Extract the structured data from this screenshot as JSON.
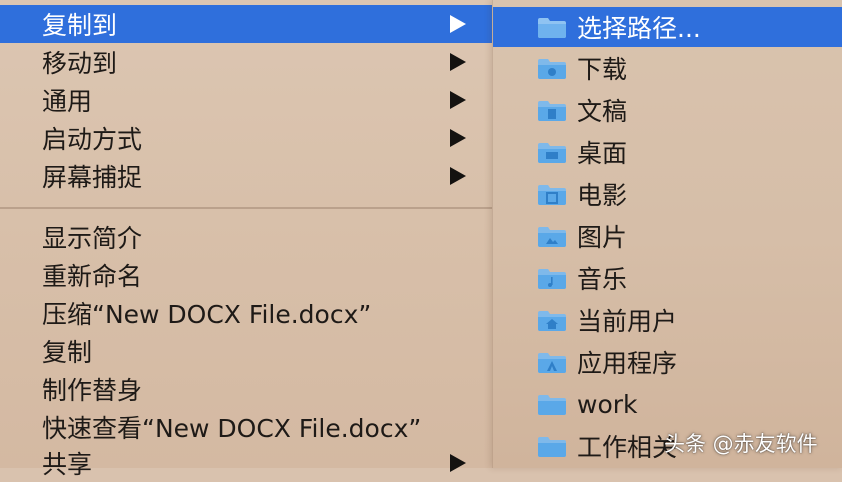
{
  "left_menu": {
    "items": [
      {
        "label": "复制到"
      },
      {
        "label": "移动到"
      },
      {
        "label": "通用"
      },
      {
        "label": "启动方式"
      },
      {
        "label": "屏幕捕捉"
      },
      {
        "label": "显示简介"
      },
      {
        "label": "重新命名"
      },
      {
        "label": "压缩“New DOCX File.docx”"
      },
      {
        "label": "复制"
      },
      {
        "label": "制作替身"
      },
      {
        "label": "快速查看“New DOCX File.docx”"
      },
      {
        "label": "共享"
      }
    ]
  },
  "right_menu": {
    "items": [
      {
        "label": "选择路径...",
        "icon": "folder-icon"
      },
      {
        "label": "下载",
        "icon": "downloads-folder-icon"
      },
      {
        "label": "文稿",
        "icon": "documents-folder-icon"
      },
      {
        "label": "桌面",
        "icon": "desktop-folder-icon"
      },
      {
        "label": "电影",
        "icon": "movies-folder-icon"
      },
      {
        "label": "图片",
        "icon": "pictures-folder-icon"
      },
      {
        "label": "音乐",
        "icon": "music-folder-icon"
      },
      {
        "label": "当前用户",
        "icon": "home-folder-icon"
      },
      {
        "label": "应用程序",
        "icon": "applications-folder-icon"
      },
      {
        "label": "work",
        "icon": "folder-icon"
      },
      {
        "label": "工作相关",
        "icon": "folder-icon"
      }
    ]
  },
  "watermark": {
    "text": "头条 @赤友软件"
  },
  "colors": {
    "highlight": "#2f6fdc",
    "menu_bg": "#d9c2ae",
    "folder_blue": "#5aa8e8"
  }
}
